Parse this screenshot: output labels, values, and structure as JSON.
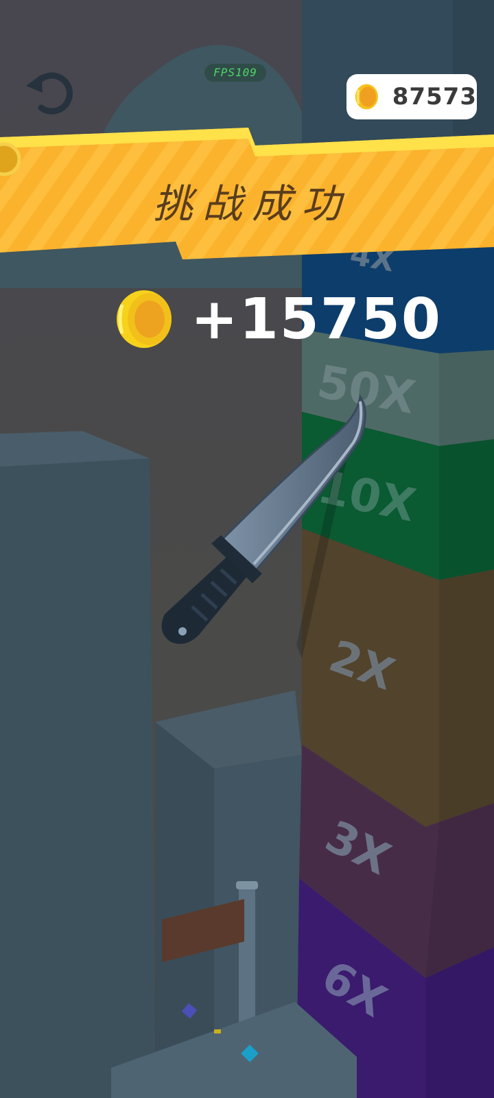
{
  "hud": {
    "fps_label": "FPS109",
    "coin_total": "87573"
  },
  "result": {
    "title": "挑战成功",
    "reward_amount": "+15750"
  },
  "tower": {
    "blocks": [
      {
        "label": "4X",
        "color": "#0d3d6b"
      },
      {
        "label": "50X",
        "color": "#4e6a66"
      },
      {
        "label": "10X",
        "color": "#0a5a32"
      },
      {
        "label": "2X",
        "color": "#51432c"
      },
      {
        "label": "3X",
        "color": "#472c48"
      },
      {
        "label": "6X",
        "color": "#3a1b6e"
      }
    ]
  },
  "colors": {
    "banner": "#fbb22c",
    "coin": "#f4c21a",
    "background": "#3f3f47"
  }
}
